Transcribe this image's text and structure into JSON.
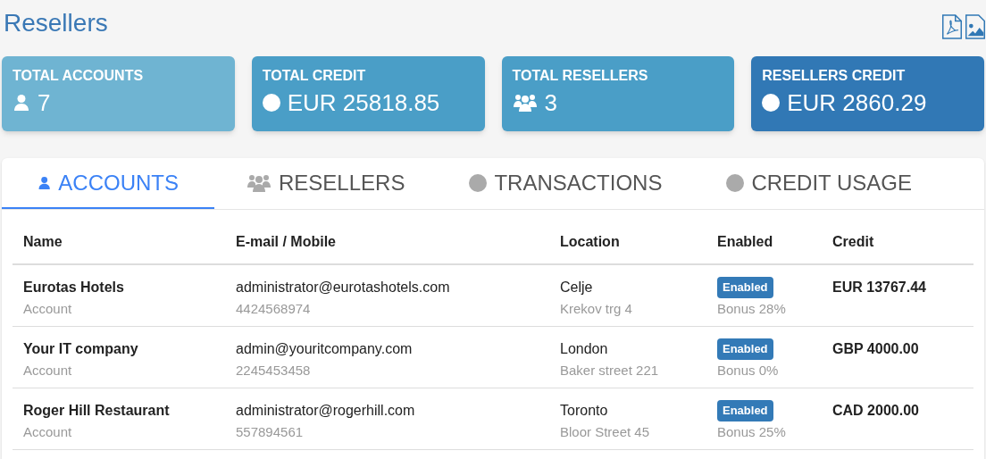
{
  "page": {
    "title": "Resellers"
  },
  "export_buttons": [
    {
      "kind": "pdf"
    },
    {
      "kind": "image"
    }
  ],
  "stats": [
    {
      "label": "TOTAL ACCOUNTS",
      "kind": "user",
      "value": "7",
      "color": "#6fb4d2"
    },
    {
      "label": "TOTAL CREDIT",
      "kind": "circle",
      "value": "EUR 25818.85",
      "color": "#4a9ec7"
    },
    {
      "label": "TOTAL RESELLERS",
      "kind": "users",
      "value": "3",
      "color": "#4a9ec7"
    },
    {
      "label": "RESELLERS CREDIT",
      "kind": "circle",
      "value": "EUR 2860.29",
      "color": "#3178b5"
    }
  ],
  "tabs": [
    {
      "label": "ACCOUNTS",
      "kind": "user",
      "selected": true
    },
    {
      "label": "RESELLERS",
      "kind": "users",
      "selected": false
    },
    {
      "label": "TRANSACTIONS",
      "kind": "circle",
      "selected": false
    },
    {
      "label": "CREDIT USAGE",
      "kind": "circle",
      "selected": false
    }
  ],
  "table": {
    "columns": [
      "Name",
      "E-mail / Mobile",
      "Location",
      "Enabled",
      "Credit"
    ],
    "rows": [
      {
        "name": "Eurotas Hotels",
        "type": "Account",
        "email": "administrator@eurotashotels.com",
        "mobile": "4424568974",
        "city": "Celje",
        "address": "Krekov trg 4",
        "enabled": true,
        "enabled_label": "Enabled",
        "bonus": "Bonus 28%",
        "credit": "EUR 13767.44"
      },
      {
        "name": "Your IT company",
        "type": "Account",
        "email": "admin@youritcompany.com",
        "mobile": "2245453458",
        "city": "London",
        "address": "Baker street 221",
        "enabled": true,
        "enabled_label": "Enabled",
        "bonus": "Bonus 0%",
        "credit": "GBP 4000.00"
      },
      {
        "name": "Roger Hill Restaurant",
        "type": "Account",
        "email": "administrator@rogerhill.com",
        "mobile": "557894561",
        "city": "Toronto",
        "address": "Bloor Street 45",
        "enabled": true,
        "enabled_label": "Enabled",
        "bonus": "Bonus 25%",
        "credit": "CAD 2000.00"
      }
    ]
  }
}
